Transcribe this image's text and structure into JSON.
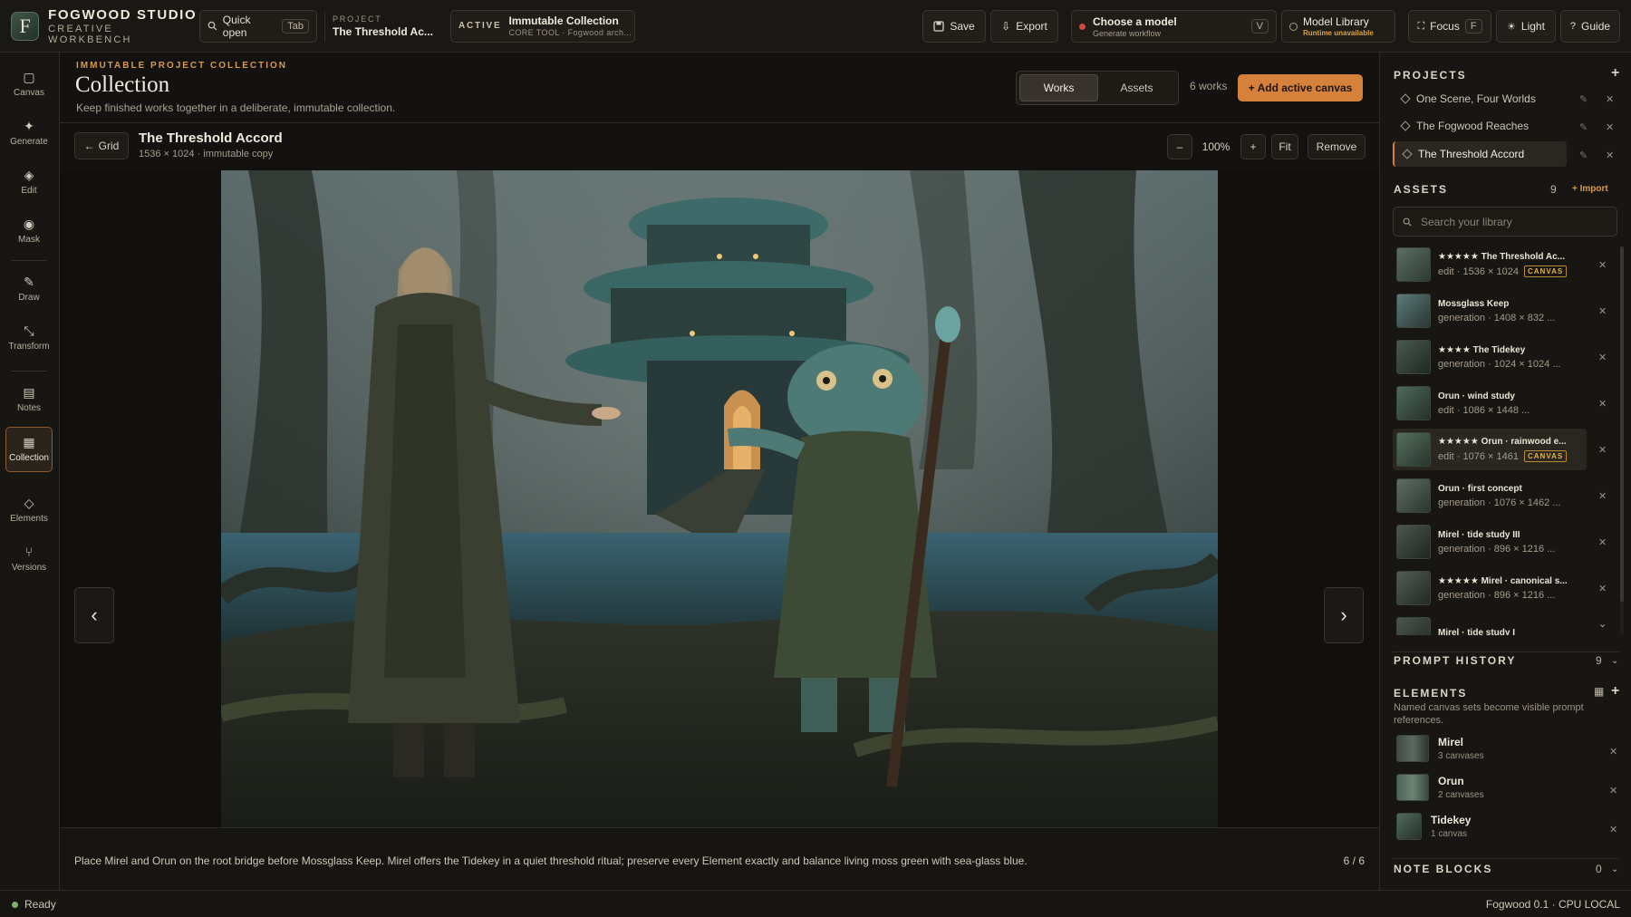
{
  "brand": {
    "logo_letter": "F",
    "name": "FOGWOOD STUDIO",
    "subtitle": "CREATIVE WORKBENCH"
  },
  "topbar": {
    "quick_open": {
      "label": "Quick open",
      "shortcut": "Tab",
      "icon": "search-icon"
    },
    "project": {
      "caption": "PROJECT",
      "name": "The Threshold Ac..."
    },
    "active": {
      "tag": "ACTIVE",
      "title": "Immutable Collection",
      "subtitle": "CORE TOOL · Fogwood arch..."
    },
    "save_label": "Save",
    "export_label": "Export",
    "model": {
      "title": "Choose a model",
      "subtitle": "Generate workflow",
      "shortcut": "V",
      "status_color": "#d4473c"
    },
    "model_library": {
      "title": "Model Library",
      "subtitle": "Runtime unavailable",
      "subtitle_color": "#d9a441"
    },
    "focus": {
      "label": "Focus",
      "shortcut": "F"
    },
    "light_label": "Light",
    "guide_label": "Guide"
  },
  "rail": [
    {
      "label": "Canvas",
      "icon": "canvas-icon"
    },
    {
      "label": "Generate",
      "icon": "sparkle-icon"
    },
    {
      "label": "Edit",
      "icon": "edit-icon"
    },
    {
      "label": "Mask",
      "icon": "mask-icon"
    },
    {
      "label": "Draw",
      "icon": "pencil-icon"
    },
    {
      "label": "Transform",
      "icon": "transform-icon"
    },
    {
      "label": "Notes",
      "icon": "notes-icon"
    },
    {
      "label": "Collection",
      "icon": "collection-icon",
      "active": true
    },
    {
      "label": "Elements",
      "icon": "elements-icon"
    },
    {
      "label": "Versions",
      "icon": "branch-icon"
    }
  ],
  "main": {
    "kicker": "IMMUTABLE PROJECT COLLECTION",
    "title": "Collection",
    "description": "Keep finished works together in a deliberate, immutable collection.",
    "tabs": [
      {
        "label": "Works",
        "active": true
      },
      {
        "label": "Assets",
        "active": false
      }
    ],
    "works_count": "6 works",
    "add_canvas_label": "+ Add active canvas",
    "accent_color": "#d6813b"
  },
  "viewer": {
    "back_label": "Grid",
    "work_title": "The Threshold Accord",
    "work_meta": "1536 × 1024 · immutable copy",
    "zoom_minus": "–",
    "zoom": "100%",
    "zoom_plus": "+",
    "fit_label": "Fit",
    "remove_label": "Remove",
    "prompt": "Place Mirel and Orun on the root bridge before Mossglass Keep. Mirel offers the Tidekey in a quiet threshold ritual; preserve every Element exactly and balance living moss green with sea-glass blue.",
    "pager": "6 / 6"
  },
  "panel": {
    "projects_title": "PROJECTS",
    "projects": [
      {
        "name": "One Scene, Four Worlds",
        "active": false
      },
      {
        "name": "The Fogwood Reaches",
        "active": false
      },
      {
        "name": "The Threshold Accord",
        "active": true
      }
    ],
    "assets_title": "ASSETS",
    "assets_count": "9",
    "import_label": "+ Import",
    "search_placeholder": "Search your library",
    "assets": [
      {
        "name": "★★★★★ The Threshold Ac...",
        "meta": "edit · 1536 × 1024",
        "badge": "CANVAS",
        "selected": false
      },
      {
        "name": "Mossglass Keep",
        "meta": "generation · 1408 × 832 ...",
        "badge": "",
        "selected": false
      },
      {
        "name": "★★★★ The Tidekey",
        "meta": "generation · 1024 × 1024 ...",
        "badge": "",
        "selected": false
      },
      {
        "name": "Orun · wind study",
        "meta": "edit · 1086 × 1448 ...",
        "badge": "",
        "selected": false
      },
      {
        "name": "★★★★★ Orun · rainwood e...",
        "meta": "edit · 1076 × 1461",
        "badge": "CANVAS",
        "selected": true
      },
      {
        "name": "Orun · first concept",
        "meta": "generation · 1076 × 1462 ...",
        "badge": "",
        "selected": false
      },
      {
        "name": "Mirel · tide study III",
        "meta": "generation · 896 × 1216 ...",
        "badge": "",
        "selected": false
      },
      {
        "name": "★★★★★ Mirel · canonical s...",
        "meta": "generation · 896 × 1216 ...",
        "badge": "",
        "selected": false
      },
      {
        "name": "Mirel · tide study I",
        "meta": "",
        "badge": "",
        "selected": false
      }
    ],
    "prompt_history_title": "PROMPT HISTORY",
    "prompt_history_count": "9",
    "elements_title": "ELEMENTS",
    "elements_desc": "Named canvas sets become visible prompt references.",
    "elements": [
      {
        "name": "Mirel",
        "count": "3 canvases"
      },
      {
        "name": "Orun",
        "count": "2 canvases"
      },
      {
        "name": "Tidekey",
        "count": "1 canvas"
      }
    ],
    "note_blocks_title": "NOTE BLOCKS",
    "note_blocks_count": "0"
  },
  "status": {
    "text": "Ready",
    "right": "Fogwood 0.1 · CPU LOCAL",
    "dot_color": "#7fb069"
  }
}
